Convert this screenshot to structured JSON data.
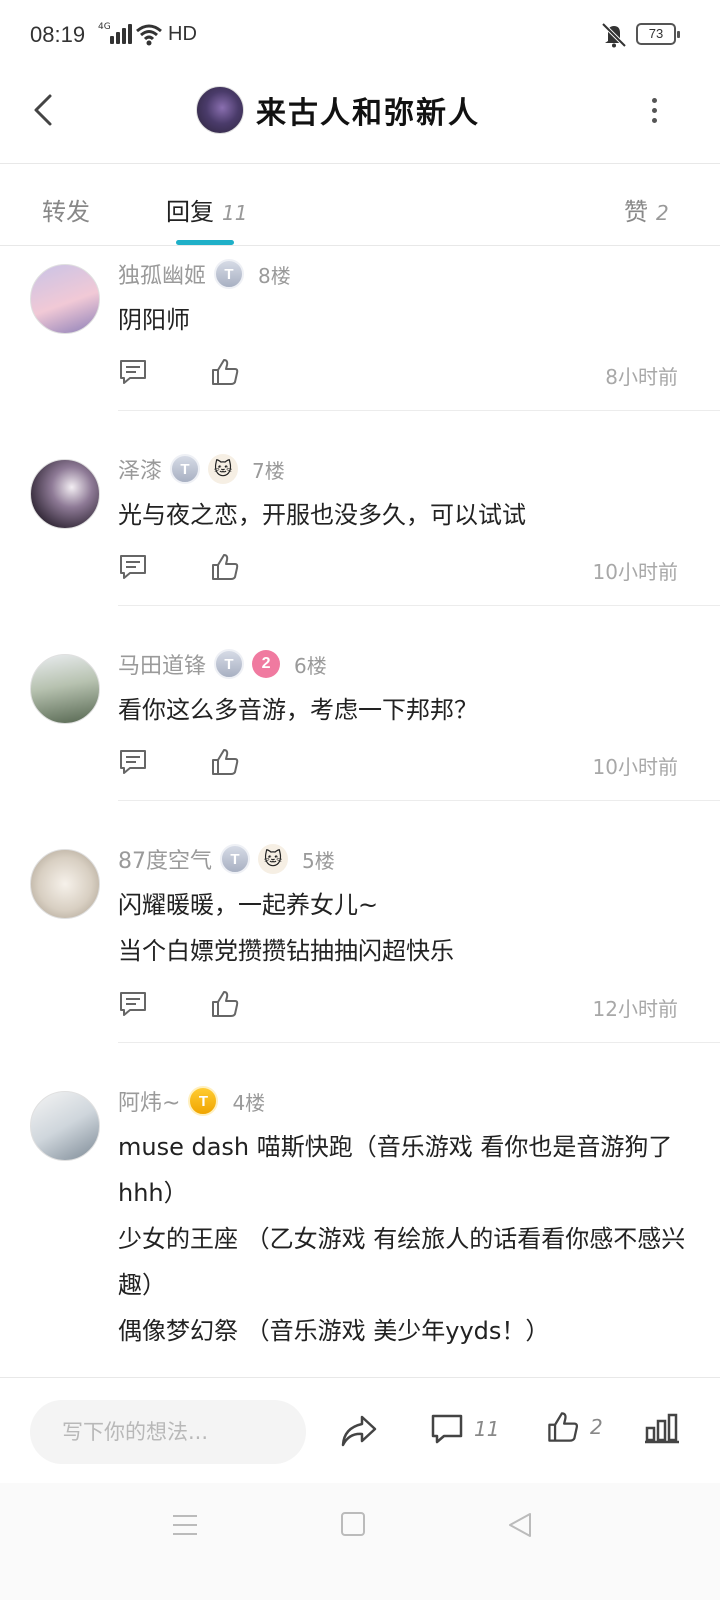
{
  "status_bar": {
    "time": "08:19",
    "network": "4G",
    "hd": "HD",
    "battery": "73"
  },
  "header": {
    "title": "来古人和弥新人"
  },
  "tabs": [
    {
      "label": "转发",
      "count": ""
    },
    {
      "label": "回复",
      "count": "11"
    },
    {
      "label": "赞",
      "count": "2"
    }
  ],
  "comments": [
    {
      "user": "独孤幽姬",
      "floor": "8楼",
      "lines": [
        "阴阳师"
      ],
      "time": "8小时前"
    },
    {
      "user": "泽漆",
      "floor": "7楼",
      "lines": [
        "光与夜之恋，开服也没多久，可以试试"
      ],
      "time": "10小时前"
    },
    {
      "user": "马田道锋",
      "badge_num": "2",
      "floor": "6楼",
      "lines": [
        "看你这么多音游，考虑一下邦邦？"
      ],
      "time": "10小时前"
    },
    {
      "user": "87度空气",
      "floor": "5楼",
      "lines": [
        "闪耀暖暖，一起养女儿~",
        "当个白嫖党攒攒钻抽抽闪超快乐"
      ],
      "time": "12小时前"
    },
    {
      "user": "阿炜~",
      "floor": "4楼",
      "lines": [
        "muse dash 喵斯快跑（音乐游戏 看你也是音游狗了hhh）",
        "少女的王座 （乙女游戏 有绘旅人的话看看你感不感兴趣）",
        "偶像梦幻祭 （音乐游戏 美少年yyds！）"
      ]
    }
  ],
  "badges": {
    "t_label": "T"
  },
  "bottom_bar": {
    "placeholder": "写下你的想法...",
    "comment_count": "11",
    "like_count": "2"
  },
  "colors": {
    "accent": "#1fb0c8",
    "badge_pink": "#f07aa0",
    "badge_gold": "#f0a500"
  }
}
